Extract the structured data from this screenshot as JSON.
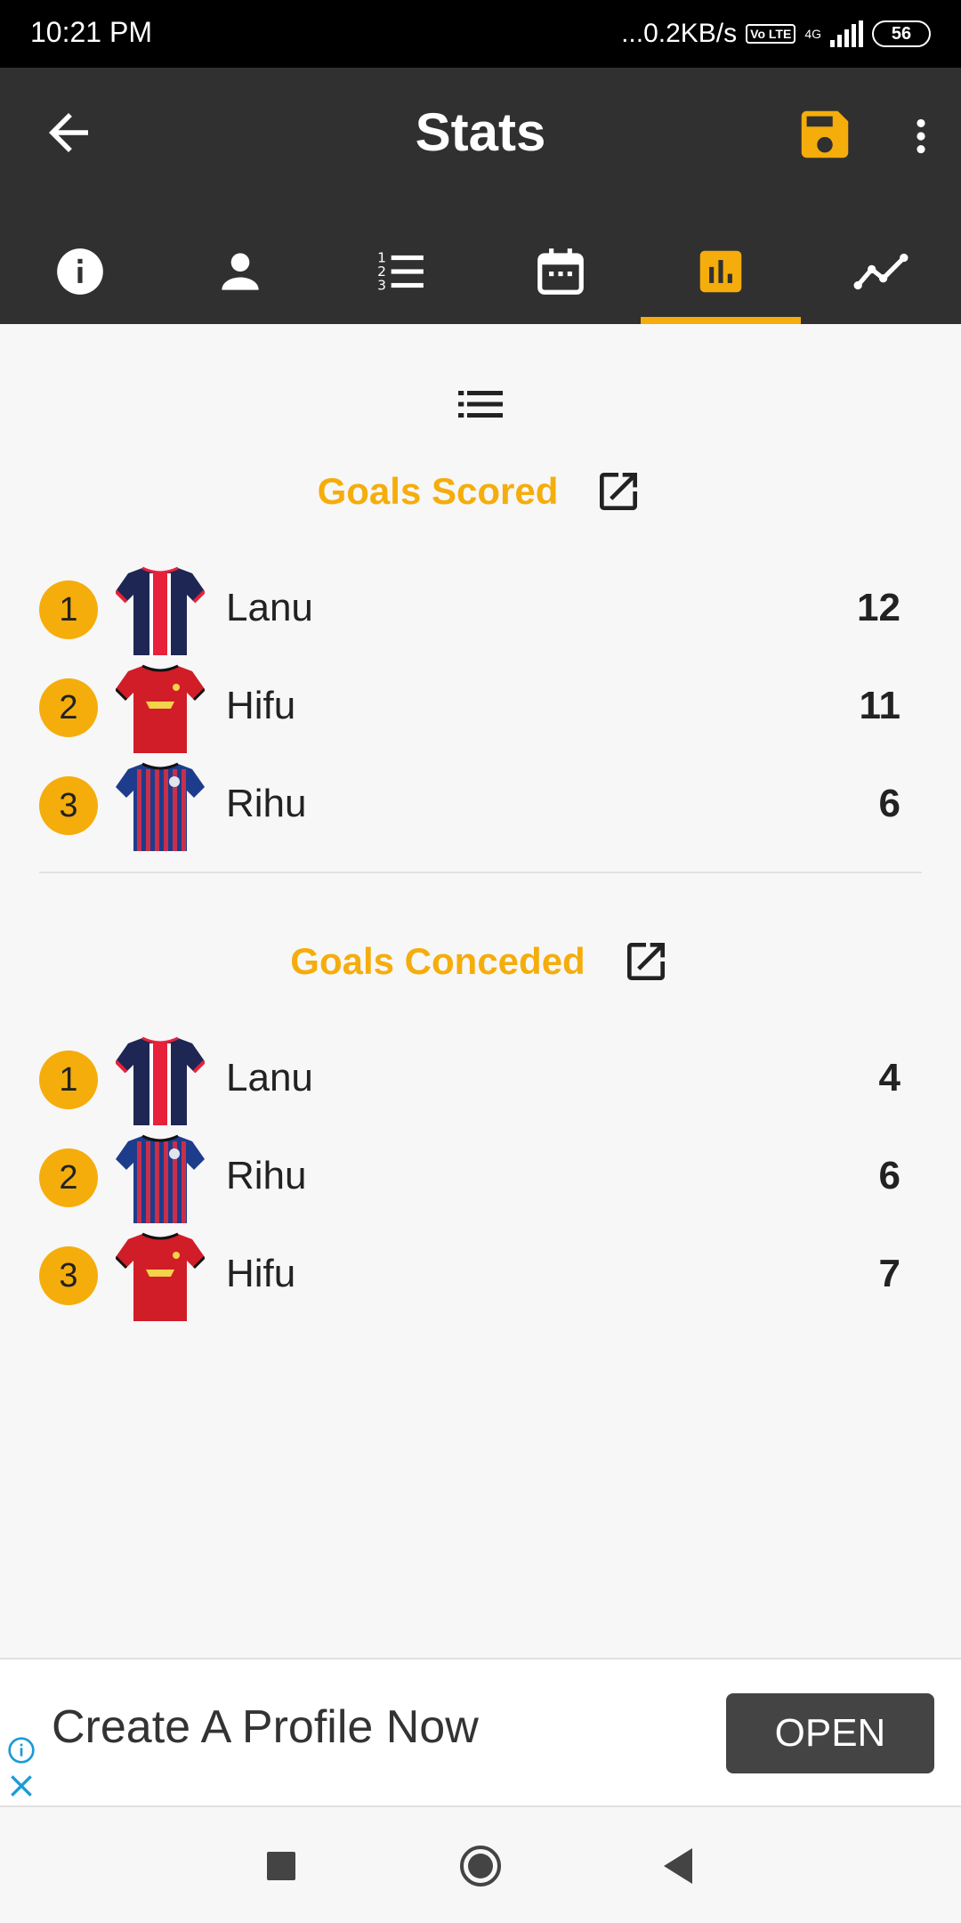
{
  "status_bar": {
    "time": "10:21 PM",
    "network_speed": "...0.2KB/s",
    "volte": "Vo LTE",
    "network_type": "4G",
    "battery": "56"
  },
  "app_bar": {
    "title": "Stats",
    "accent_color": "#f5ad0c",
    "background_color": "#303030"
  },
  "tabs": [
    {
      "icon": "info-icon",
      "active": false
    },
    {
      "icon": "person-icon",
      "active": false
    },
    {
      "icon": "numbered-list-icon",
      "active": false
    },
    {
      "icon": "calendar-icon",
      "active": false
    },
    {
      "icon": "bar-chart-icon",
      "active": true
    },
    {
      "icon": "trend-line-icon",
      "active": false
    }
  ],
  "goals_scored": {
    "title": "Goals Scored",
    "rows": [
      {
        "rank": "1",
        "name": "Lanu",
        "value": "12",
        "jersey": "navy-red-stripe"
      },
      {
        "rank": "2",
        "name": "Hifu",
        "value": "11",
        "jersey": "red"
      },
      {
        "rank": "3",
        "name": "Rihu",
        "value": "6",
        "jersey": "blue-red-stripes"
      }
    ]
  },
  "goals_conceded": {
    "title": "Goals Conceded",
    "rows": [
      {
        "rank": "1",
        "name": "Lanu",
        "value": "4",
        "jersey": "navy-red-stripe"
      },
      {
        "rank": "2",
        "name": "Rihu",
        "value": "6",
        "jersey": "blue-red-stripes"
      },
      {
        "rank": "3",
        "name": "Hifu",
        "value": "7",
        "jersey": "red"
      }
    ]
  },
  "ad": {
    "text": "Create A Profile Now",
    "button": "OPEN"
  }
}
